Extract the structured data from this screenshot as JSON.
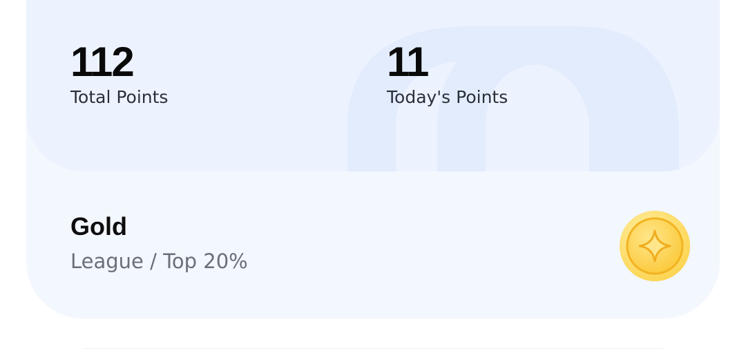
{
  "stats": {
    "total_points_value": "112",
    "total_points_label": "Total Points",
    "today_points_value": "11",
    "today_points_label": "Today's Points"
  },
  "league": {
    "name": "Gold",
    "subtitle": "League / Top 20%",
    "badge_icon": "gold-coin-star-icon"
  },
  "colors": {
    "card_background": "#f3f7fe",
    "stats_background": "#edf3fe",
    "arch_color": "#e3ecfd",
    "medal_gold": "#fcd34d"
  }
}
